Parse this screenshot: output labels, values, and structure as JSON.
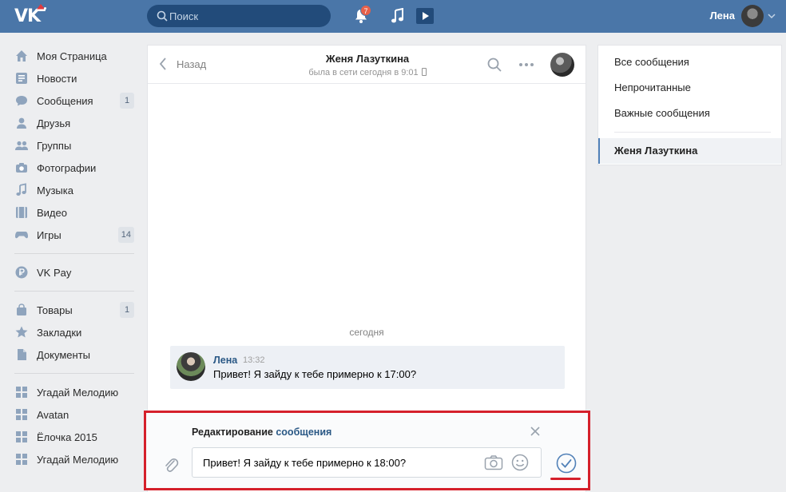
{
  "header": {
    "logo_text": "VK",
    "search_placeholder": "Поиск",
    "notifications_count": "7",
    "user_name": "Лена",
    "icons": [
      "bell-icon",
      "music-icon",
      "video-icon",
      "chevron-down-icon"
    ]
  },
  "sidebar": {
    "items": [
      {
        "label": "Моя Страница",
        "icon": "home-icon",
        "count": ""
      },
      {
        "label": "Новости",
        "icon": "news-icon",
        "count": ""
      },
      {
        "label": "Сообщения",
        "icon": "messages-icon",
        "count": "1"
      },
      {
        "label": "Друзья",
        "icon": "friends-icon",
        "count": ""
      },
      {
        "label": "Группы",
        "icon": "groups-icon",
        "count": ""
      },
      {
        "label": "Фотографии",
        "icon": "camera-icon",
        "count": ""
      },
      {
        "label": "Музыка",
        "icon": "music-icon",
        "count": ""
      },
      {
        "label": "Видео",
        "icon": "video-icon",
        "count": ""
      },
      {
        "label": "Игры",
        "icon": "games-icon",
        "count": "14"
      }
    ],
    "pay": {
      "label": "VK Pay",
      "icon": "rouble-icon"
    },
    "items2": [
      {
        "label": "Товары",
        "icon": "bag-icon",
        "count": "1"
      },
      {
        "label": "Закладки",
        "icon": "star-icon",
        "count": ""
      },
      {
        "label": "Документы",
        "icon": "document-icon",
        "count": ""
      }
    ],
    "apps": [
      {
        "label": "Угадай Мелодию",
        "icon": "app-icon"
      },
      {
        "label": "Avatan",
        "icon": "app-icon"
      },
      {
        "label": "Ёлочка 2015",
        "icon": "app-icon"
      },
      {
        "label": "Угадай Мелодию",
        "icon": "app-icon"
      }
    ]
  },
  "chat": {
    "back_label": "Назад",
    "peer_name": "Женя Лазуткина",
    "peer_status": "была в сети сегодня в 9:01",
    "day_separator": "сегодня",
    "message": {
      "author": "Лена",
      "time": "13:32",
      "text": "Привет! Я зайду к тебе примерно к 17:00?"
    },
    "edit": {
      "title_prefix": "Редактирование",
      "title_link": "сообщения",
      "input_value": "Привет! Я зайду к тебе примерно к 18:00?"
    }
  },
  "right_menu": {
    "items": [
      "Все сообщения",
      "Непрочитанные",
      "Важные сообщения"
    ],
    "active_item": "Женя Лазуткина"
  },
  "colors": {
    "header_bg": "#4a76a8",
    "link": "#2a5885",
    "highlight_frame": "#d5202b",
    "message_bg": "#edf0f5"
  }
}
